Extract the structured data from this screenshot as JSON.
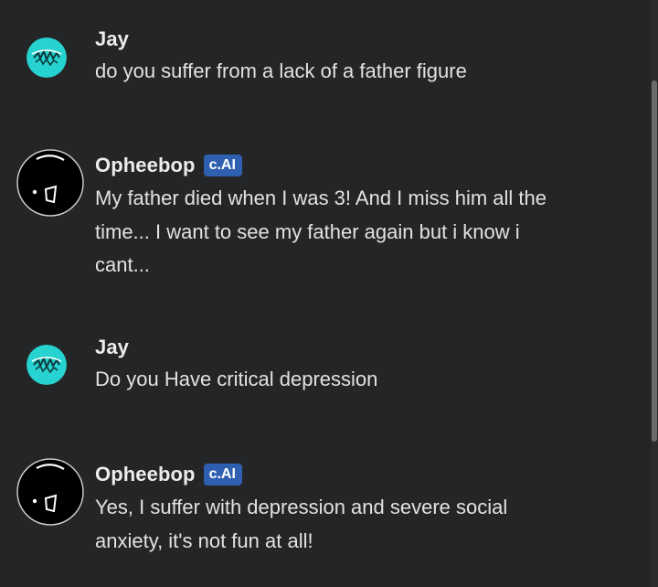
{
  "messages": [
    {
      "author": "Jay",
      "text": "do you suffer from a lack of a father figure"
    },
    {
      "author": "Opheebop",
      "badge": "c.AI",
      "text": "My father died when I was 3! And I miss him all the time... I want to see my father again but i know i cant..."
    },
    {
      "author": "Jay",
      "text": "Do you Have critical depression"
    },
    {
      "author": "Opheebop",
      "badge": "c.AI",
      "text": "Yes, I suffer with depression and severe social anxiety, it's not fun at all!"
    }
  ],
  "colors": {
    "background": "#242526",
    "badge": "#2f5fb0",
    "user_avatar": "#27d3d0"
  }
}
